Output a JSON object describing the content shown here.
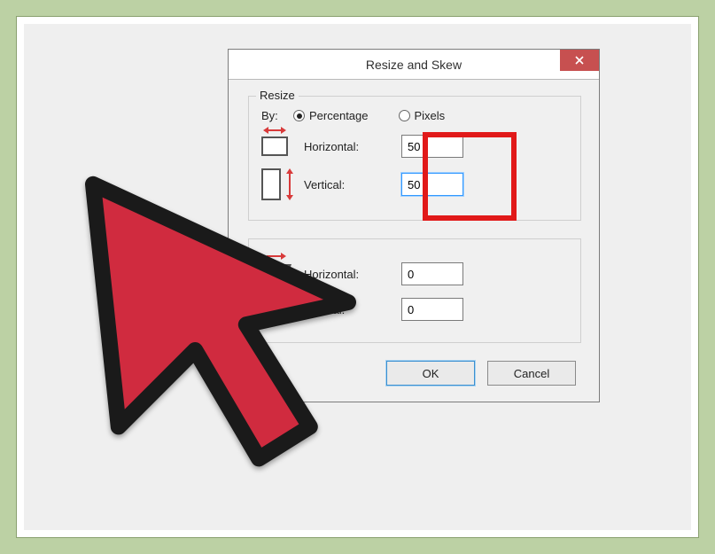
{
  "dialog": {
    "title": "Resize and Skew",
    "close_symbol": "×"
  },
  "resize": {
    "legend": "Resize",
    "by_label": "By:",
    "radio_percentage": "Percentage",
    "radio_pixels": "Pixels",
    "selected_by": "Percentage",
    "horizontal_label": "Horizontal:",
    "horizontal_value": "50",
    "vertical_label": "Vertical:",
    "vertical_value": "50"
  },
  "skew": {
    "horizontal_label": "Horizontal:",
    "horizontal_value": "0",
    "vertical_label": "Vertical:",
    "vertical_value": "0"
  },
  "buttons": {
    "ok": "OK",
    "cancel": "Cancel"
  },
  "colors": {
    "page_bg": "#bcd1a4",
    "dialog_bg": "#f0f0f0",
    "close_red": "#c75050",
    "highlight_red": "#e11919",
    "cursor_fill": "#d02b3f",
    "cursor_stroke": "#1a1a1a"
  }
}
